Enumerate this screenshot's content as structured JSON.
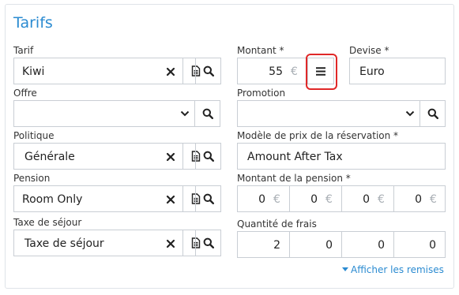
{
  "section": {
    "title": "Tarifs"
  },
  "tarif": {
    "label": "Tarif",
    "value": "Kiwi"
  },
  "offre": {
    "label": "Offre",
    "value": ""
  },
  "politique": {
    "label": "Politique",
    "value": "Générale"
  },
  "pension": {
    "label": "Pension",
    "value": "Room Only"
  },
  "taxe": {
    "label": "Taxe de séjour",
    "value": "Taxe de séjour"
  },
  "montant": {
    "label": "Montant *",
    "value": "55",
    "currency": "€"
  },
  "devise": {
    "label": "Devise *",
    "value": "Euro"
  },
  "promotion": {
    "label": "Promotion",
    "value": ""
  },
  "modele": {
    "label": "Modèle de prix de la réservation *",
    "value": "Amount After Tax"
  },
  "montant_pension": {
    "label": "Montant de la pension *",
    "values": [
      "0",
      "0",
      "0",
      "0"
    ],
    "currency": "€"
  },
  "quantite_frais": {
    "label": "Quantité de frais",
    "values": [
      "2",
      "0",
      "0",
      "0"
    ]
  },
  "remises_link": {
    "label": "Afficher les remises"
  },
  "colors": {
    "accent": "#2b8bd1",
    "highlight": "#e02828",
    "border": "#c9ced4"
  }
}
